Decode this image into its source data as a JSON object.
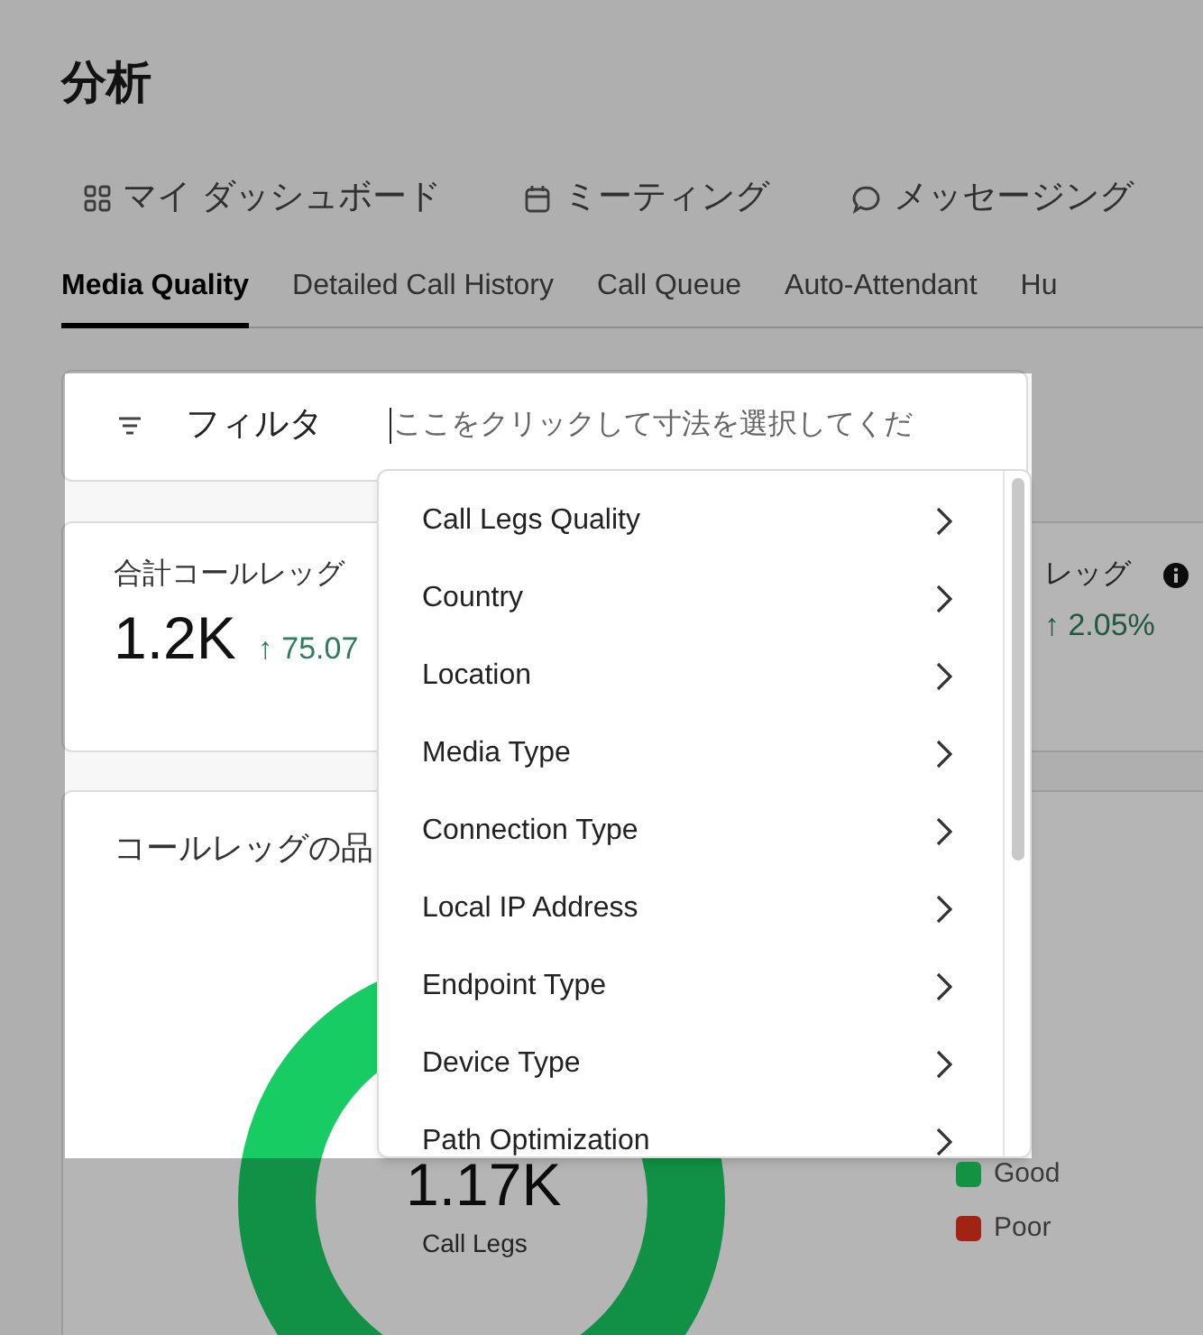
{
  "page_title": "分析",
  "nav": [
    {
      "label": "マイ ダッシュボード",
      "kind": "dashboard"
    },
    {
      "label": "ミーティング",
      "kind": "meetings"
    },
    {
      "label": "メッセージング",
      "kind": "messaging"
    }
  ],
  "tabs": [
    {
      "label": "Media Quality",
      "selected": true
    },
    {
      "label": "Detailed Call History",
      "selected": false
    },
    {
      "label": "Call Queue",
      "selected": false
    },
    {
      "label": "Auto-Attendant",
      "selected": false
    },
    {
      "label": "Hu",
      "selected": false
    }
  ],
  "filter": {
    "label": "フィルタ",
    "placeholder": "ここをクリックして寸法を選択してくだ"
  },
  "stats": [
    {
      "title": "合計コールレッグ",
      "value": "1.2K",
      "change": "↑ 75.07"
    },
    {
      "title": "レッグ",
      "change": "↑ 2.05%",
      "info_icon": true
    }
  ],
  "dimension_menu": {
    "items": [
      "Call Legs Quality",
      "Country",
      "Location",
      "Media Type",
      "Connection Type",
      "Local IP Address",
      "Endpoint Type",
      "Device Type",
      "Path Optimization"
    ]
  },
  "quality_card": {
    "title": "コールレッグの品",
    "center_value": "1.17K",
    "center_label": "Call Legs",
    "legend": [
      {
        "label": "Good",
        "color": "#149244"
      },
      {
        "label": "Poor",
        "color": "#a02313"
      }
    ]
  }
}
